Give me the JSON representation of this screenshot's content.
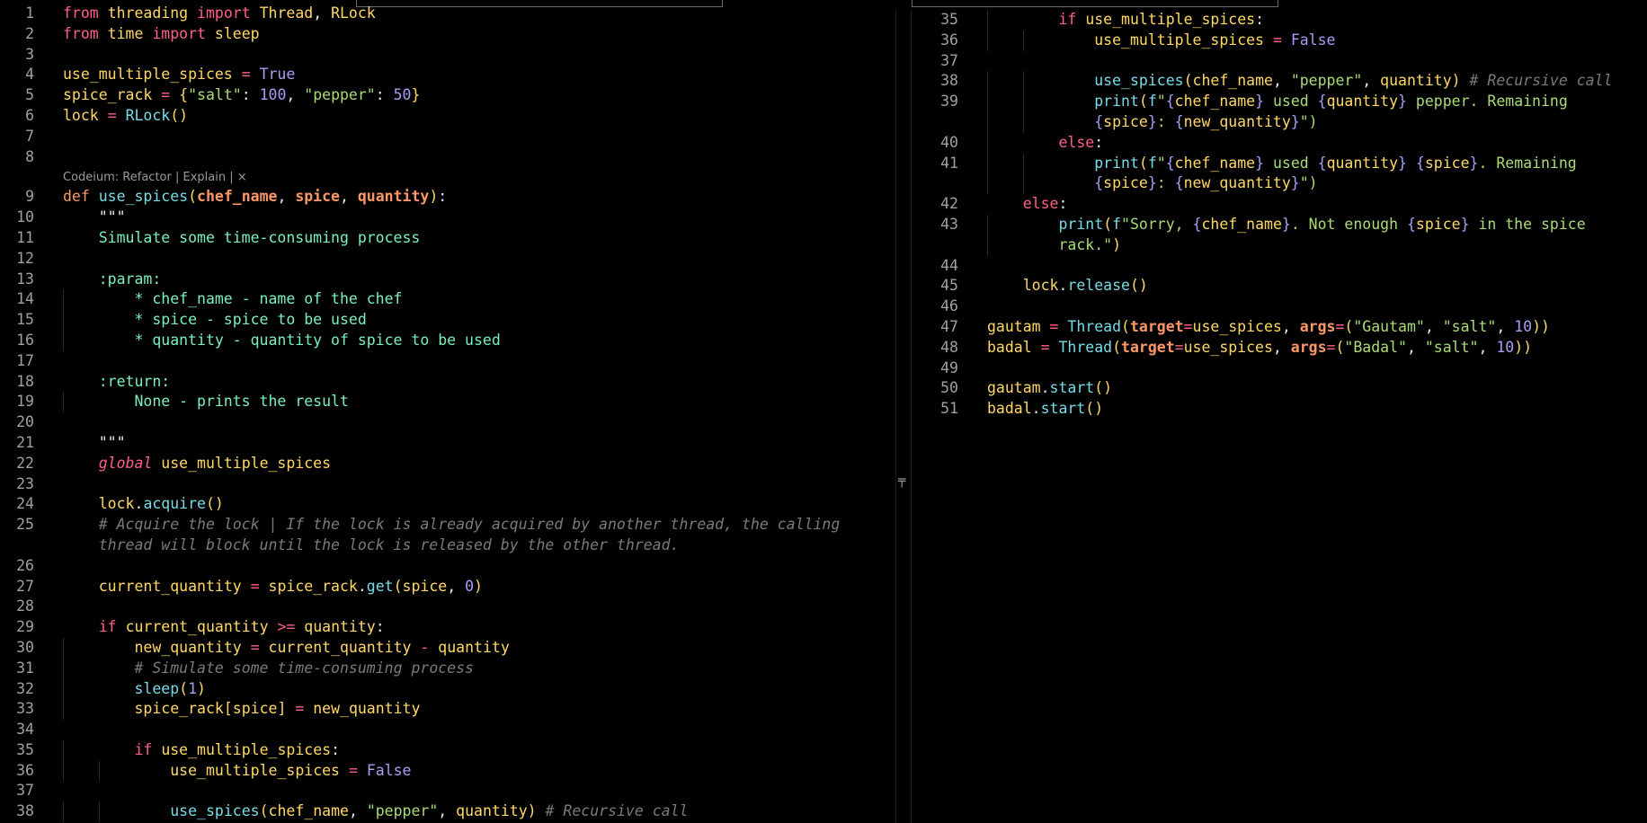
{
  "lens": "Codeium: Refactor | Explain | ×",
  "left_lines": [
    {
      "n": "1",
      "t": "from threading import Thread, RLock"
    },
    {
      "n": "2",
      "t": "from time import sleep"
    },
    {
      "n": "3",
      "t": ""
    },
    {
      "n": "4",
      "t": "use_multiple_spices = True"
    },
    {
      "n": "5",
      "t": "spice_rack = {\"salt\": 100, \"pepper\": 50}"
    },
    {
      "n": "6",
      "t": "lock = RLock()"
    },
    {
      "n": "7",
      "t": ""
    },
    {
      "n": "8",
      "t": ""
    },
    {
      "n": "9",
      "t": "def use_spices(chef_name, spice, quantity):"
    },
    {
      "n": "10",
      "t": "    \"\"\""
    },
    {
      "n": "11",
      "t": "    Simulate some time-consuming process"
    },
    {
      "n": "12",
      "t": ""
    },
    {
      "n": "13",
      "t": "    :param:"
    },
    {
      "n": "14",
      "t": "        * chef_name - name of the chef"
    },
    {
      "n": "15",
      "t": "        * spice - spice to be used"
    },
    {
      "n": "16",
      "t": "        * quantity - quantity of spice to be used"
    },
    {
      "n": "17",
      "t": ""
    },
    {
      "n": "18",
      "t": "    :return:"
    },
    {
      "n": "19",
      "t": "        None - prints the result"
    },
    {
      "n": "20",
      "t": ""
    },
    {
      "n": "21",
      "t": "    \"\"\""
    },
    {
      "n": "22",
      "t": "    global use_multiple_spices"
    },
    {
      "n": "23",
      "t": ""
    },
    {
      "n": "24",
      "t": "    lock.acquire()"
    },
    {
      "n": "25",
      "t": "    # Acquire the lock | If the lock is already acquired by another thread, the calling"
    },
    {
      "n": "",
      "t": "    thread will block until the lock is released by the other thread."
    },
    {
      "n": "26",
      "t": ""
    },
    {
      "n": "27",
      "t": "    current_quantity = spice_rack.get(spice, 0)"
    },
    {
      "n": "28",
      "t": ""
    },
    {
      "n": "29",
      "t": "    if current_quantity >= quantity:"
    },
    {
      "n": "30",
      "t": "        new_quantity = current_quantity - quantity"
    },
    {
      "n": "31",
      "t": "        # Simulate some time-consuming process"
    },
    {
      "n": "32",
      "t": "        sleep(1)"
    },
    {
      "n": "33",
      "t": "        spice_rack[spice] = new_quantity"
    },
    {
      "n": "34",
      "t": ""
    },
    {
      "n": "35",
      "t": "        if use_multiple_spices:"
    },
    {
      "n": "36",
      "t": "            use_multiple_spices = False"
    },
    {
      "n": "37",
      "t": ""
    },
    {
      "n": "38",
      "t": "            use_spices(chef_name, \"pepper\", quantity) # Recursive call"
    }
  ],
  "right_lines": [
    {
      "n": "35",
      "t": "        if use_multiple_spices:"
    },
    {
      "n": "36",
      "t": "            use_multiple_spices = False"
    },
    {
      "n": "37",
      "t": ""
    },
    {
      "n": "38",
      "t": "            use_spices(chef_name, \"pepper\", quantity) # Recursive call"
    },
    {
      "n": "39",
      "t": "            print(f\"{chef_name} used {quantity} pepper. Remaining"
    },
    {
      "n": "",
      "t": "            {spice}: {new_quantity}\")"
    },
    {
      "n": "40",
      "t": "        else:"
    },
    {
      "n": "41",
      "t": "            print(f\"{chef_name} used {quantity} {spice}. Remaining"
    },
    {
      "n": "",
      "t": "            {spice}: {new_quantity}\")"
    },
    {
      "n": "42",
      "t": "    else:"
    },
    {
      "n": "43",
      "t": "        print(f\"Sorry, {chef_name}. Not enough {spice} in the spice"
    },
    {
      "n": "",
      "t": "        rack.\")"
    },
    {
      "n": "44",
      "t": ""
    },
    {
      "n": "45",
      "t": "    lock.release()"
    },
    {
      "n": "46",
      "t": ""
    },
    {
      "n": "47",
      "t": "gautam = Thread(target=use_spices, args=(\"Gautam\", \"salt\", 10))"
    },
    {
      "n": "48",
      "t": "badal = Thread(target=use_spices, args=(\"Badal\", \"salt\", 10))"
    },
    {
      "n": "49",
      "t": ""
    },
    {
      "n": "50",
      "t": "gautam.start()"
    },
    {
      "n": "51",
      "t": "badal.start()"
    }
  ]
}
